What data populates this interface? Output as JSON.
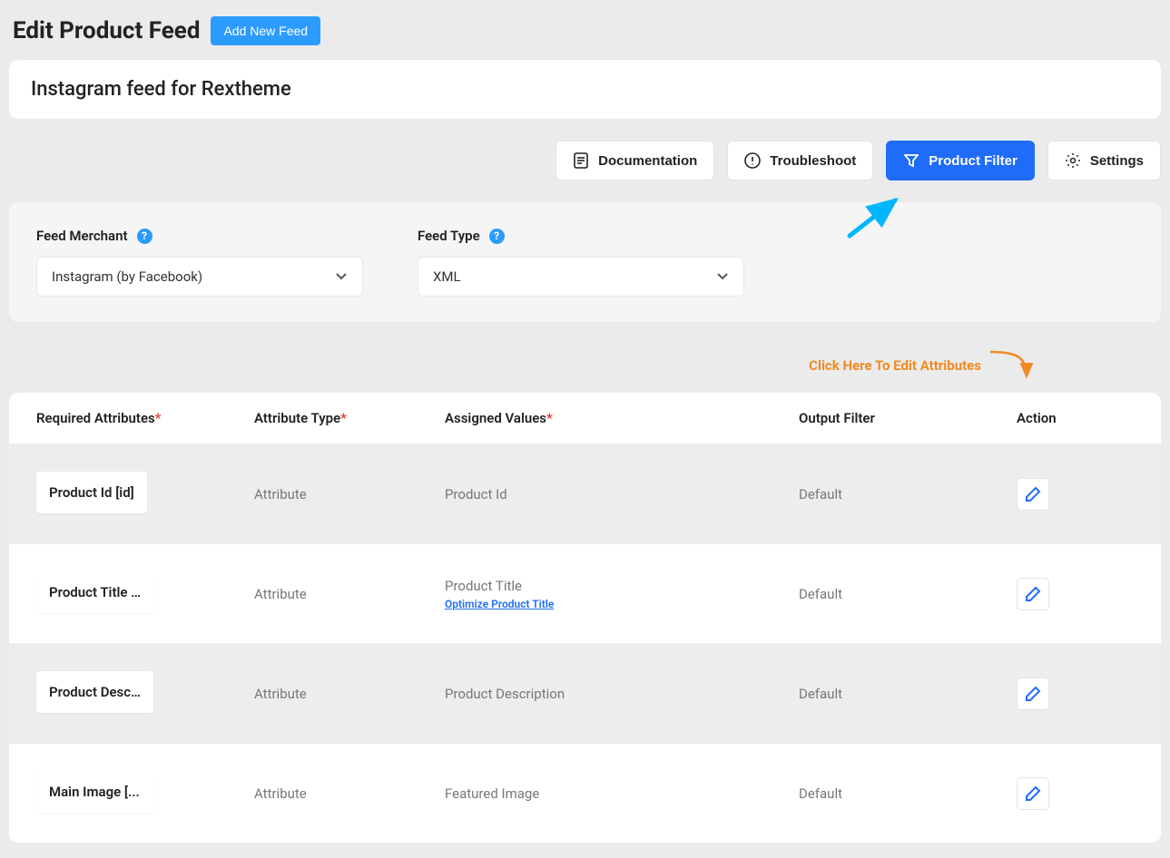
{
  "header": {
    "page_title": "Edit Product Feed",
    "add_new_label": "Add New Feed",
    "feed_name": "Instagram feed for Rextheme"
  },
  "toolbar": {
    "documentation": "Documentation",
    "troubleshoot": "Troubleshoot",
    "product_filter": "Product Filter",
    "settings": "Settings"
  },
  "merchant": {
    "feed_merchant_label": "Feed Merchant",
    "feed_merchant_value": "Instagram (by Facebook)",
    "feed_type_label": "Feed Type",
    "feed_type_value": "XML"
  },
  "edit_attrs_hint": "Click Here To Edit Attributes",
  "table": {
    "headers": {
      "required": "Required Attributes",
      "attr_type": "Attribute Type",
      "assigned": "Assigned Values",
      "output_filter": "Output Filter",
      "action": "Action"
    },
    "rows": [
      {
        "required": "Product Id [id]",
        "attr_type": "Attribute",
        "assigned": "Product Id",
        "optimize": null,
        "output_filter": "Default"
      },
      {
        "required": "Product Title …",
        "attr_type": "Attribute",
        "assigned": "Product Title",
        "optimize": "Optimize Product Title",
        "output_filter": "Default"
      },
      {
        "required": "Product Desc…",
        "attr_type": "Attribute",
        "assigned": "Product Description",
        "optimize": null,
        "output_filter": "Default"
      },
      {
        "required": "Main Image [...",
        "attr_type": "Attribute",
        "assigned": "Featured Image",
        "optimize": null,
        "output_filter": "Default"
      }
    ]
  }
}
